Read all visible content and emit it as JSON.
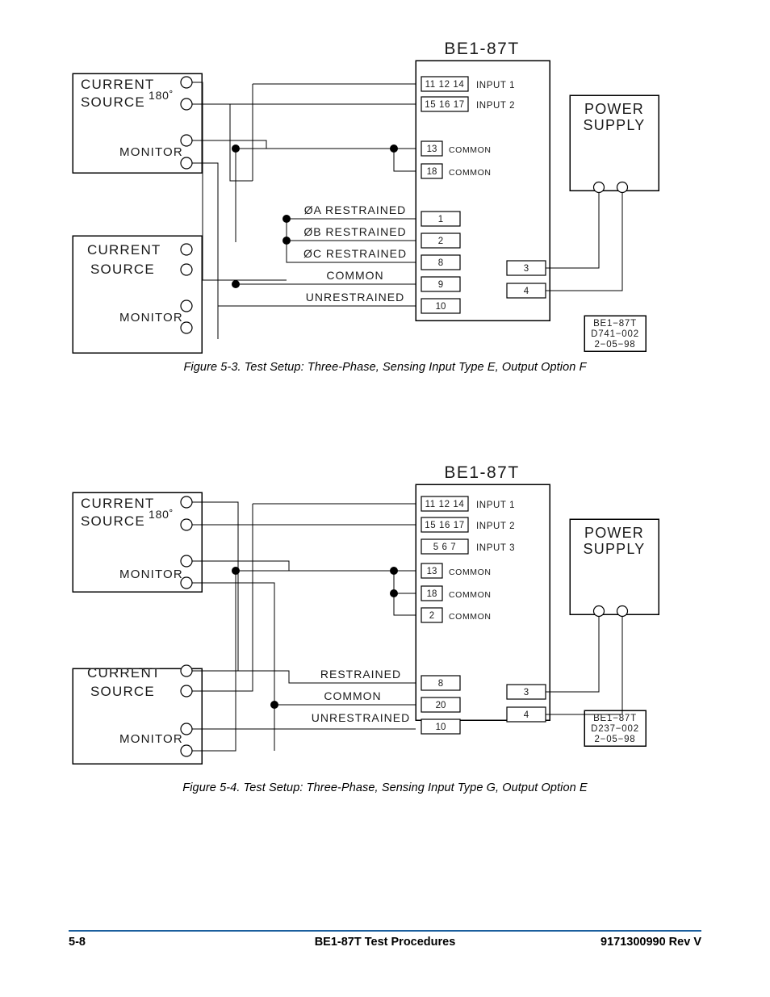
{
  "document": {
    "footer": {
      "page_number": "5-8",
      "title": "BE1-87T Test Procedures",
      "doc_number": "9171300990 Rev V",
      "rule_color": "#1b5f9e"
    }
  },
  "figures": [
    {
      "id": "figure-5-3",
      "caption": "Figure 5-3. Test Setup: Three-Phase, Sensing Input Type E, Output Option F",
      "relay": {
        "title": "BE1-87T",
        "terminals": [
          {
            "pins": "11 12 14",
            "label": "INPUT 1"
          },
          {
            "pins": "15 16 17",
            "label": "INPUT 2"
          },
          {
            "pins": "13",
            "label": "COMMON"
          },
          {
            "pins": "18",
            "label": "COMMON"
          },
          {
            "pins": "1",
            "label": ""
          },
          {
            "pins": "2",
            "label": ""
          },
          {
            "pins": "8",
            "label": ""
          },
          {
            "pins": "9",
            "label": ""
          },
          {
            "pins": "10",
            "label": ""
          },
          {
            "pins": "3",
            "label": ""
          },
          {
            "pins": "4",
            "label": ""
          }
        ],
        "wire_labels": [
          "ØA  RESTRAINED",
          "ØB  RESTRAINED",
          "ØC  RESTRAINED",
          "COMMON",
          "UNRESTRAINED"
        ]
      },
      "power_supply": {
        "line1": "POWER",
        "line2": "SUPPLY"
      },
      "sources": [
        {
          "line1": "CURRENT",
          "line2": "SOURCE",
          "phase": "180˚",
          "monitor": "MONITOR"
        },
        {
          "line1": "CURRENT",
          "line2": "SOURCE",
          "phase": "",
          "monitor": "MONITOR"
        }
      ],
      "drawing_ref": {
        "line1": "BE1−87T",
        "line2": "D741−002",
        "line3": "2−05−98"
      }
    },
    {
      "id": "figure-5-4",
      "caption": "Figure 5-4. Test Setup: Three-Phase, Sensing Input Type G, Output Option E",
      "relay": {
        "title": "BE1-87T",
        "terminals": [
          {
            "pins": "11 12 14",
            "label": "INPUT 1"
          },
          {
            "pins": "15 16 17",
            "label": "INPUT 2"
          },
          {
            "pins": "5  6  7",
            "label": "INPUT 3"
          },
          {
            "pins": "13",
            "label": "COMMON"
          },
          {
            "pins": "18",
            "label": "COMMON"
          },
          {
            "pins": "2",
            "label": "COMMON"
          },
          {
            "pins": "8",
            "label": ""
          },
          {
            "pins": "20",
            "label": ""
          },
          {
            "pins": "10",
            "label": ""
          },
          {
            "pins": "3",
            "label": ""
          },
          {
            "pins": "4",
            "label": ""
          }
        ],
        "wire_labels": [
          "RESTRAINED",
          "COMMON",
          "UNRESTRAINED"
        ]
      },
      "power_supply": {
        "line1": "POWER",
        "line2": "SUPPLY"
      },
      "sources": [
        {
          "line1": "CURRENT",
          "line2": "SOURCE",
          "phase": "180˚",
          "monitor": "MONITOR"
        },
        {
          "line1": "CURRENT",
          "line2": "SOURCE",
          "phase": "",
          "monitor": "MONITOR"
        }
      ],
      "drawing_ref": {
        "line1": "BE1−87T",
        "line2": "D237−002",
        "line3": "2−05−98"
      }
    }
  ]
}
